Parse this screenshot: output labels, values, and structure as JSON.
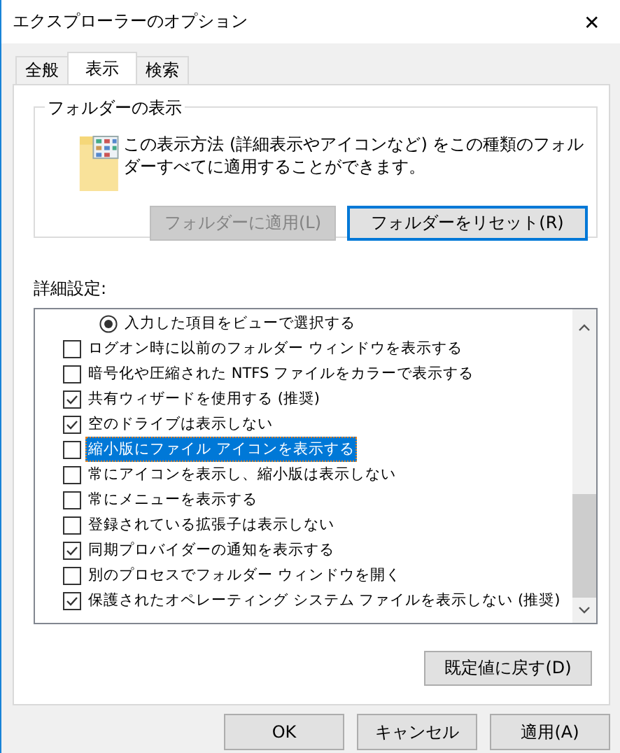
{
  "window": {
    "title": "エクスプローラーのオプション",
    "close": "✕"
  },
  "tabs": [
    {
      "label": "全般",
      "selected": false
    },
    {
      "label": "表示",
      "selected": true
    },
    {
      "label": "検索",
      "selected": false
    }
  ],
  "folder_views": {
    "title": "フォルダーの表示",
    "description": "この表示方法 (詳細表示やアイコンなど) をこの種類のフォルダーすべてに適用することができます。",
    "buttons": [
      {
        "label": "フォルダーに適用(L)",
        "disabled": true,
        "focused": false
      },
      {
        "label": "フォルダーをリセット(R)",
        "disabled": false,
        "focused": true
      }
    ]
  },
  "advanced": {
    "label": "詳細設定:",
    "items": [
      {
        "kind": "radio",
        "label": "入力した項目をビューで選択する",
        "checked": true,
        "selected": false
      },
      {
        "kind": "checkbox",
        "label": "ログオン時に以前のフォルダー ウィンドウを表示する",
        "checked": false,
        "selected": false
      },
      {
        "kind": "checkbox",
        "label": "暗号化や圧縮された NTFS ファイルをカラーで表示する",
        "checked": false,
        "selected": false
      },
      {
        "kind": "checkbox",
        "label": "共有ウィザードを使用する (推奨)",
        "checked": true,
        "selected": false
      },
      {
        "kind": "checkbox",
        "label": "空のドライブは表示しない",
        "checked": true,
        "selected": false
      },
      {
        "kind": "checkbox",
        "label": "縮小版にファイル アイコンを表示する",
        "checked": false,
        "selected": true
      },
      {
        "kind": "checkbox",
        "label": "常にアイコンを表示し、縮小版は表示しない",
        "checked": false,
        "selected": false
      },
      {
        "kind": "checkbox",
        "label": "常にメニューを表示する",
        "checked": false,
        "selected": false
      },
      {
        "kind": "checkbox",
        "label": "登録されている拡張子は表示しない",
        "checked": false,
        "selected": false
      },
      {
        "kind": "checkbox",
        "label": "同期プロバイダーの通知を表示する",
        "checked": true,
        "selected": false
      },
      {
        "kind": "checkbox",
        "label": "別のプロセスでフォルダー ウィンドウを開く",
        "checked": false,
        "selected": false
      },
      {
        "kind": "checkbox",
        "label": "保護されたオペレーティング システム ファイルを表示しない (推奨)",
        "checked": true,
        "selected": false
      }
    ],
    "restore_button": "既定値に戻す(D)"
  },
  "buttons": [
    "OK",
    "キャンセル",
    "適用(A)"
  ]
}
